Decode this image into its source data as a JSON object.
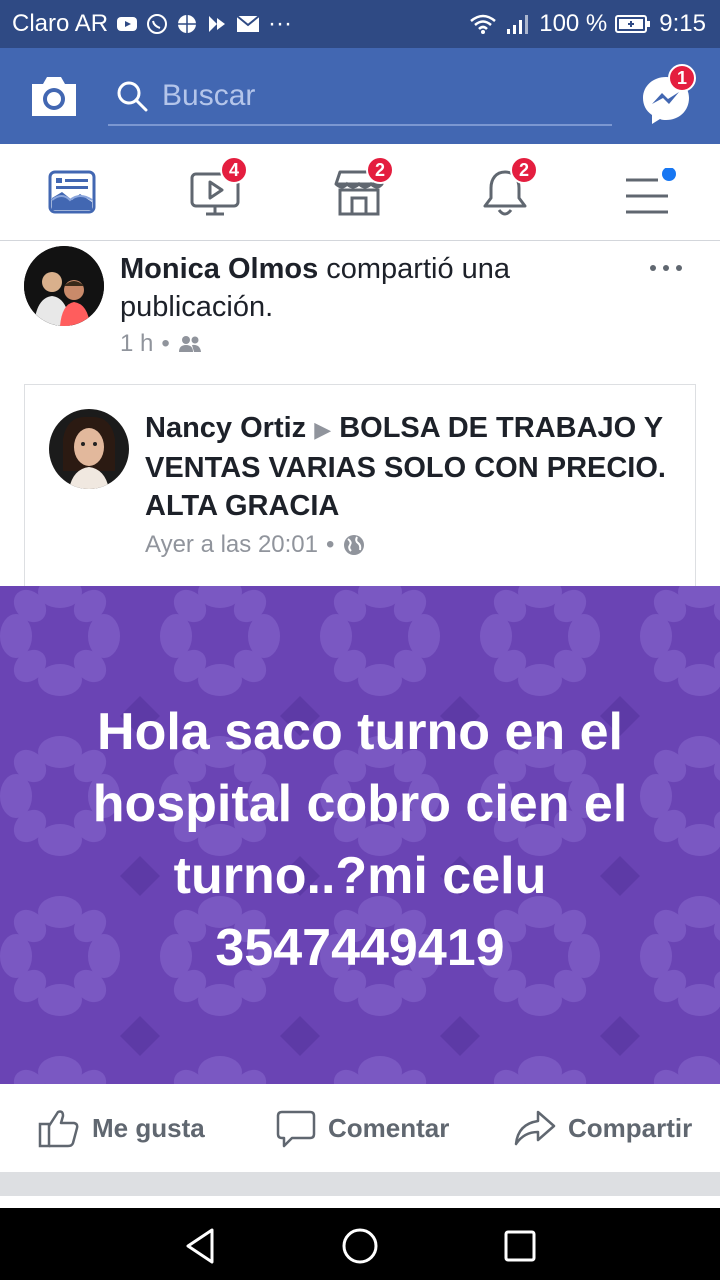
{
  "status_bar": {
    "carrier": "Claro AR",
    "overflow": "···",
    "battery": "100 %",
    "time": "9:15"
  },
  "top_bar": {
    "search_placeholder": "Buscar",
    "messenger_badge": "1"
  },
  "nav_tabs": [
    {
      "name": "news-feed",
      "badge": ""
    },
    {
      "name": "watch",
      "badge": "4"
    },
    {
      "name": "marketplace",
      "badge": "2"
    },
    {
      "name": "notifications",
      "badge": "2"
    },
    {
      "name": "menu",
      "badge": ""
    }
  ],
  "post": {
    "author": "Monica Olmos",
    "action": " compartió una publicación.",
    "time": "1 h",
    "separator": "•",
    "shared": {
      "author": "Nancy Ortiz",
      "arrow": "▶",
      "group": "BOLSA DE TRABAJO Y VENTAS VARIAS SOLO CON PRECIO. ALTA GRACIA",
      "time": "Ayer a las 20:01",
      "separator": "•"
    },
    "body_lines": [
      "Hola saco turno en el",
      "hospital cobro cien el",
      "turno..?mi celu",
      "3547449419"
    ],
    "background_color": "#6a44b4"
  },
  "actions": {
    "like": "Me gusta",
    "comment": "Comentar",
    "share": "Compartir"
  },
  "colors": {
    "status_bar": "#2f4a84",
    "brand": "#4267b2",
    "badge": "#e41e3f"
  }
}
